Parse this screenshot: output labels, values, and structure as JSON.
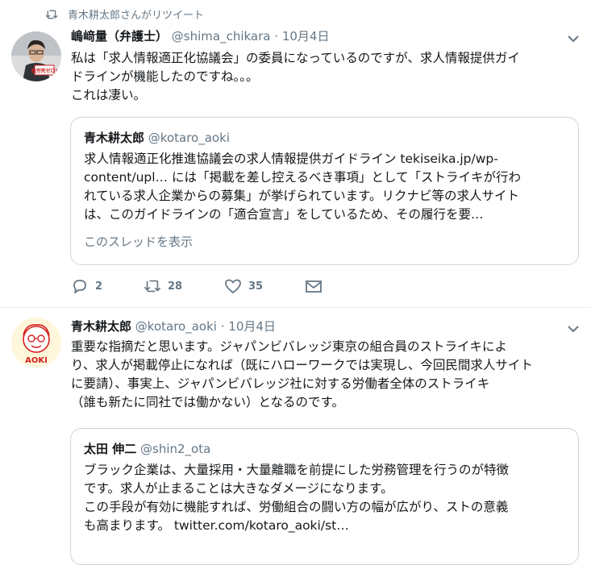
{
  "retweet_notice": "青木耕太郎さんがリツイート",
  "tweet1": {
    "name": "嶋﨑量（弁護士）",
    "handle": "@shima_chikara",
    "separator": "·",
    "date": "10月4日",
    "avatar_badge": "過労死ゼロ!",
    "text_lines": [
      "私は「求人情報適正化協議会」の委員になっているのですが、求人情報提供ガイ",
      "ドラインが機能したのですね。。。",
      "これは凄い。"
    ],
    "quote": {
      "name": "青木耕太郎",
      "handle": "@kotaro_aoki",
      "text_lines": [
        "求人情報適正化推進協議会の求人情報提供ガイドライン tekiseika.jp/wp-",
        "content/upl… には「掲載を差し控えるべき事項」として「ストライキが行わ",
        "れている求人企業からの募集」が挙げられています。リクナビ等の求人サイト",
        "は、このガイドラインの「適合宣言」をしているため、その履行を要…"
      ],
      "thread_link": "このスレッドを表示"
    },
    "actions": {
      "replies": "2",
      "retweets": "28",
      "likes": "35"
    }
  },
  "tweet2": {
    "name": "青木耕太郎",
    "handle": "@kotaro_aoki",
    "separator": "·",
    "date": "10月4日",
    "avatar_label": "AOKI",
    "text_lines": [
      "重要な指摘だと思います。ジャパンビバレッジ東京の組合員のストライキによ",
      "り、求人が掲載停止になれば（既にハローワークでは実現し、今回民間求人サイト",
      "に要請）、事実上、ジャパンビバレッジ社に対する労働者全体のストライキ",
      "（誰も新たに同社では働かない）となるのです。"
    ],
    "quote": {
      "name": "太田 伸二",
      "handle": "@shin2_ota",
      "text_lines": [
        "ブラック企業は、大量採用・大量離職を前提にした労務管理を行うのが特徴",
        "です。求人が止まることは大きなダメージになります。",
        "この手段が有効に機能すれば、労働組合の闘い方の幅が広がり、ストの意義",
        "も高まります。 twitter.com/kotaro_aoki/st…"
      ]
    }
  },
  "colors": {
    "text": "#14171a",
    "secondary": "#657786",
    "border": "#ccd6dd",
    "divider": "#e6ecf0"
  },
  "icons": [
    "retweet-icon",
    "chevron-down-icon",
    "reply-icon",
    "like-icon",
    "dm-icon"
  ]
}
